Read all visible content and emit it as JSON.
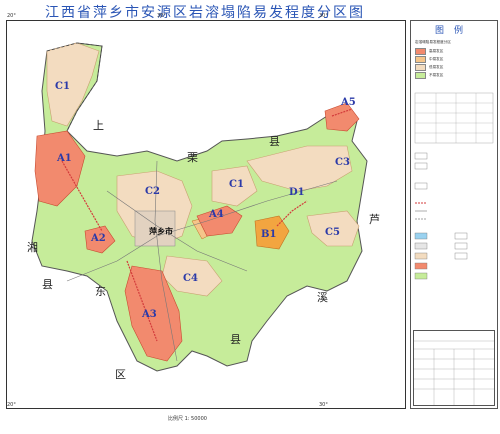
{
  "title": "江西省萍乡市安源区岩溶塌陷易发程度分区图",
  "ticks": {
    "top_left": "20°",
    "top_mid": "30°",
    "top_right": "30°",
    "bottom_left": "20°",
    "bottom_right": "30°"
  },
  "region_labels": [
    "上",
    "栗",
    "县",
    "芦",
    "溪",
    "县",
    "区",
    "东",
    "湘",
    "县"
  ],
  "zones": [
    "C1",
    "A1",
    "C2",
    "C1",
    "A2",
    "C4",
    "B1",
    "C3",
    "D1",
    "A4",
    "A3",
    "A5",
    "C5"
  ],
  "city": "萍乡市",
  "scale_text": "比例尺 1: 50000",
  "legend": {
    "title": "图例",
    "items": [
      {
        "label": "岩溶塌陷易发程度分区",
        "color": "#ffffff"
      },
      {
        "label": "高易发区",
        "color": "#f28a6e"
      },
      {
        "label": "中易发区",
        "color": "#f5c58a"
      },
      {
        "label": "低易发区",
        "color": "#f3dcc0"
      },
      {
        "label": "不易发区",
        "color": "#c6ec9a"
      }
    ]
  },
  "colors": {
    "high": "#f28a6e",
    "medium": "#f5c58a",
    "low": "#f3dcc0",
    "none": "#c6ec9a",
    "orange": "#f2a540",
    "title": "#2a55b5",
    "fault": "#d33b3b"
  }
}
